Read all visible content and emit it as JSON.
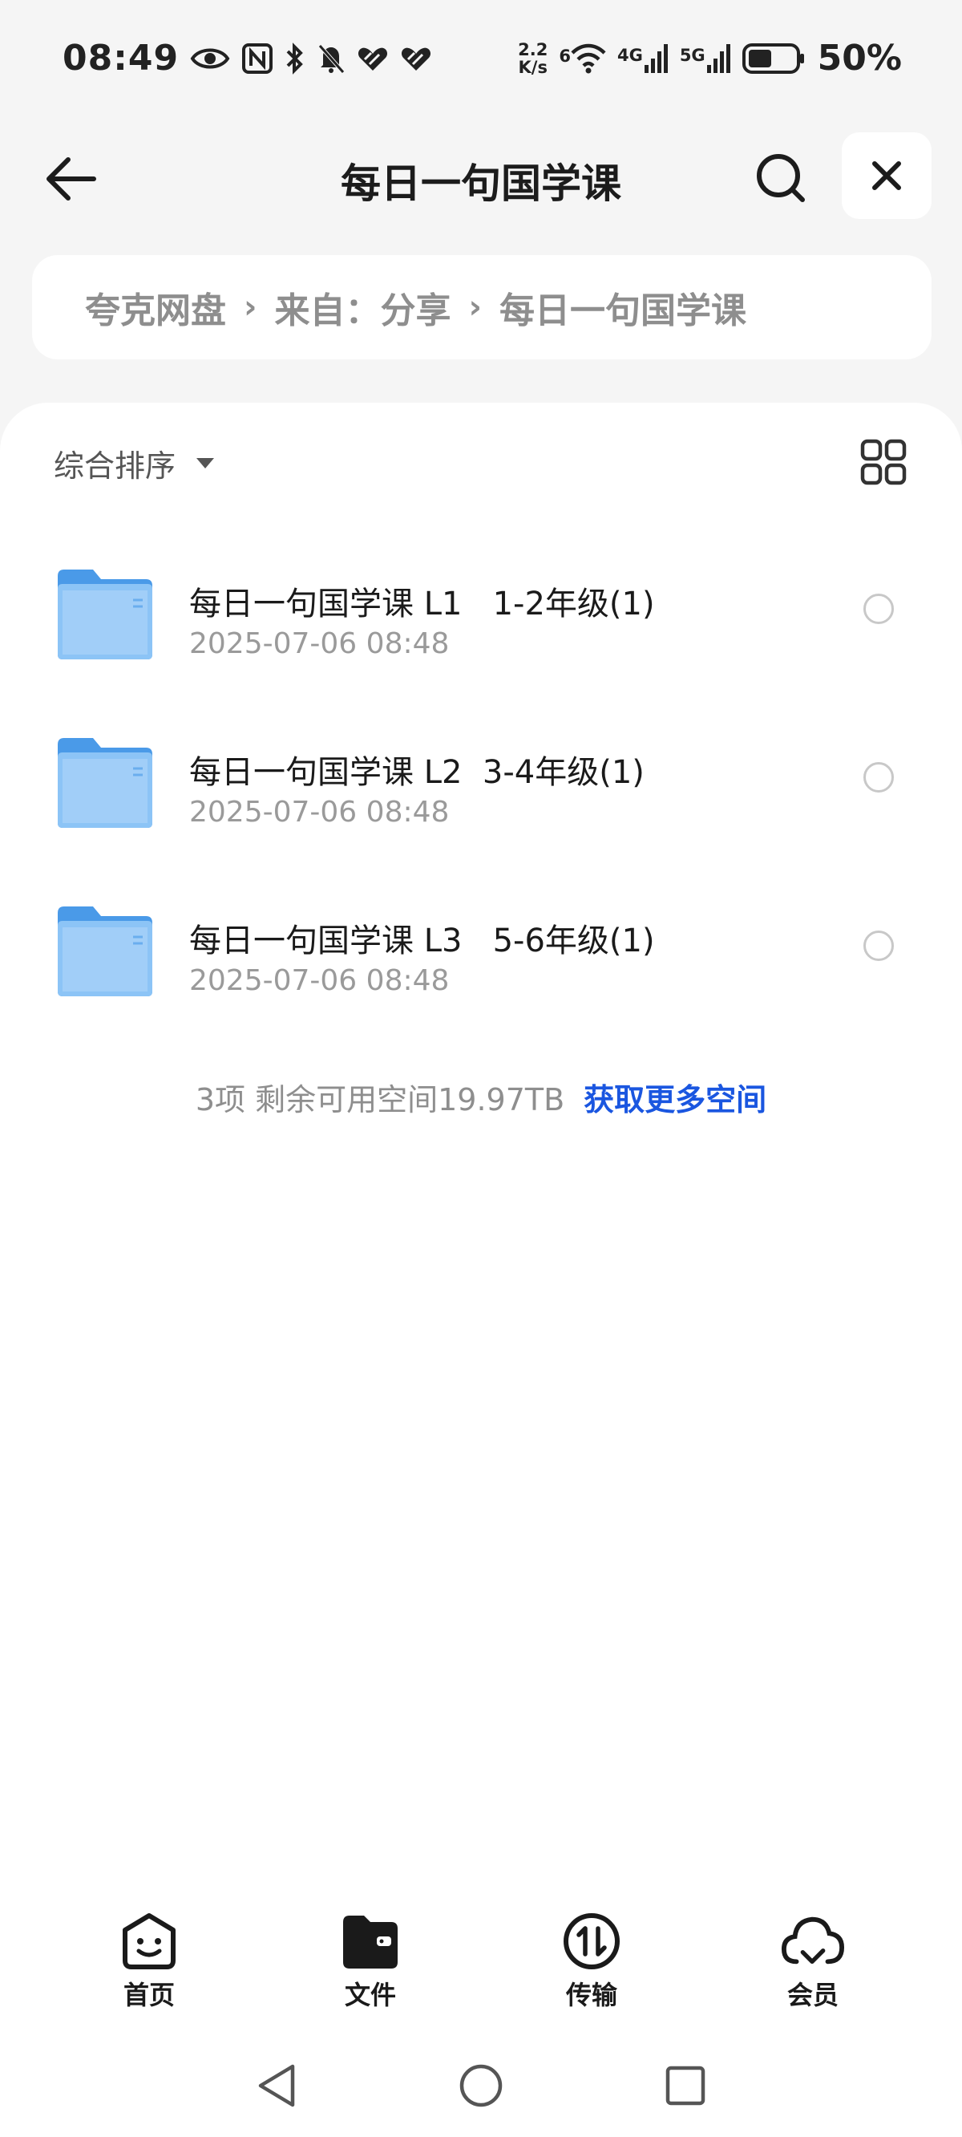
{
  "status_bar": {
    "time": "08:49",
    "net_speed_value": "2.2",
    "net_speed_unit": "K/s",
    "wifi_label": "6",
    "signal1_label": "4G",
    "signal2_label": "5G",
    "battery_percent_text": "50%",
    "battery_level": 0.5,
    "icons": [
      "eye-icon",
      "nfc-icon",
      "bluetooth-icon",
      "bell-off-icon",
      "heart-link-icon",
      "heart-link-icon",
      "wifi-icon",
      "signal-icon",
      "signal-icon",
      "battery-icon"
    ]
  },
  "header": {
    "title": "每日一句国学课",
    "back_icon": "arrow-left-icon",
    "search_icon": "search-icon",
    "close_icon": "close-icon"
  },
  "breadcrumb": {
    "items": [
      "夸克网盘",
      "来自：分享",
      "每日一句国学课"
    ],
    "separator": "›"
  },
  "toolbar": {
    "sort_label": "综合排序",
    "view_toggle_icon": "grid-view-icon"
  },
  "files": [
    {
      "name": "每日一句国学课 L1   1-2年级(1)",
      "time": "2025-07-06 08:48",
      "icon": "folder-icon"
    },
    {
      "name": "每日一句国学课 L2  3-4年级(1)",
      "time": "2025-07-06 08:48",
      "icon": "folder-icon"
    },
    {
      "name": "每日一句国学课 L3   5-6年级(1)",
      "time": "2025-07-06 08:48",
      "icon": "folder-icon"
    }
  ],
  "footer": {
    "summary": "3项 剩余可用空间19.97TB",
    "more_space_link": "获取更多空间"
  },
  "bottom_nav": [
    {
      "label": "首页",
      "icon": "home-smile-icon"
    },
    {
      "label": "文件",
      "icon": "folder-file-icon"
    },
    {
      "label": "传输",
      "icon": "transfer-icon"
    },
    {
      "label": "会员",
      "icon": "cloud-icon"
    }
  ],
  "system_nav": {
    "icons": [
      "back-triangle-icon",
      "home-circle-icon",
      "recents-square-icon"
    ]
  },
  "colors": {
    "background": "#f5f5f5",
    "card": "#ffffff",
    "accent_link": "#1a56e0",
    "folder_blue": "#5aa8f0",
    "muted_text": "#9a9a9a"
  }
}
